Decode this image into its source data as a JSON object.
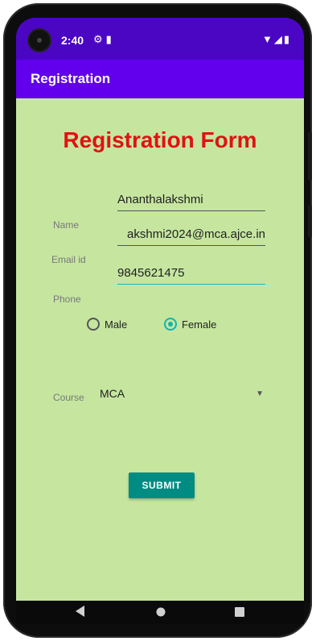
{
  "status_bar": {
    "time": "2:40",
    "left_icons": [
      "settings-icon",
      "sd-card-icon"
    ],
    "right_icons": [
      "wifi-icon",
      "signal-icon",
      "battery-icon"
    ]
  },
  "app_bar": {
    "title": "Registration"
  },
  "form": {
    "title": "Registration Form",
    "name_label": "Name",
    "name_value": "Ananthalakshmi",
    "email_label": "Email id",
    "email_value": "akshmi2024@mca.ajce.in",
    "phone_label": "Phone",
    "phone_value": "9845621475",
    "gender_options": [
      {
        "label": "Male",
        "checked": false
      },
      {
        "label": "Female",
        "checked": true
      }
    ],
    "course_label": "Course",
    "course_value": "MCA",
    "submit_label": "SUBMIT"
  },
  "colors": {
    "status_bar": "#4b06c4",
    "app_bar": "#6200ee",
    "content_bg": "#c6e6a0",
    "title_red": "#e01212",
    "accent_teal": "#008c82"
  },
  "nav_bar": {
    "icons": [
      "back-icon",
      "home-icon",
      "recents-icon"
    ]
  }
}
